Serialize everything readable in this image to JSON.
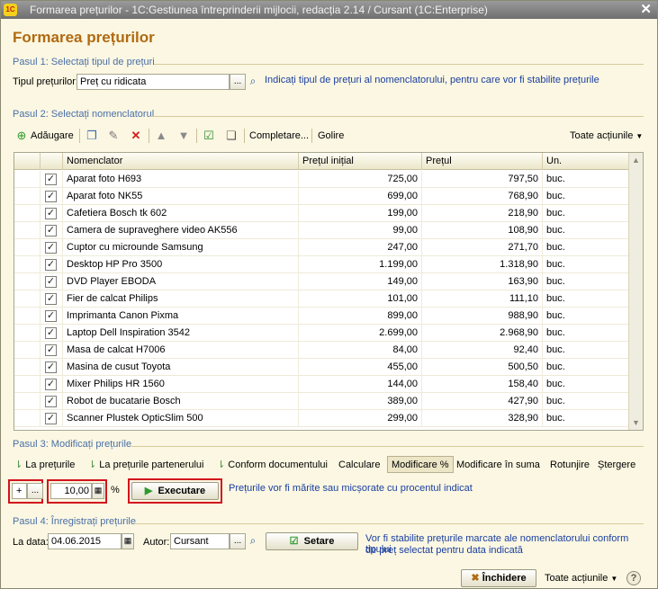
{
  "window": {
    "title": "Formarea prețurilor - 1C:Gestiunea întreprinderii mijlocii, redacția 2.14 / Cursant  (1C:Enterprise)",
    "logo_text": "1C",
    "close_glyph": "✕"
  },
  "heading": "Formarea prețurilor",
  "step1": {
    "title": "Pasul 1: Selectați tipul de prețuri",
    "label": "Tipul prețurilor:",
    "value": "Preț cu ridicata",
    "select_glyph": "...",
    "hint": "Indicați tipul de prețuri al nomenclatorului, pentru care vor fi stabilite prețurile"
  },
  "step2": {
    "title": "Pasul 2: Selectați nomenclatorul",
    "toolbar": {
      "add": "Adăugare",
      "fill": "Completare...",
      "clear": "Golire",
      "all_actions": "Toate acțiunile"
    },
    "columns": [
      "Nomenclator",
      "Prețul inițial",
      "Prețul",
      "Un."
    ],
    "rows": [
      {
        "name": "Aparat foto H693",
        "initial": "725,00",
        "price": "797,50",
        "unit": "buc."
      },
      {
        "name": "Aparat foto NK55",
        "initial": "699,00",
        "price": "768,90",
        "unit": "buc."
      },
      {
        "name": "Cafetiera Bosch tk 602",
        "initial": "199,00",
        "price": "218,90",
        "unit": "buc."
      },
      {
        "name": "Camera de supraveghere video AK556",
        "initial": "99,00",
        "price": "108,90",
        "unit": "buc."
      },
      {
        "name": "Cuptor cu microunde Samsung",
        "initial": "247,00",
        "price": "271,70",
        "unit": "buc."
      },
      {
        "name": "Desktop HP Pro 3500",
        "initial": "1.199,00",
        "price": "1.318,90",
        "unit": "buc."
      },
      {
        "name": "DVD Player EBODA",
        "initial": "149,00",
        "price": "163,90",
        "unit": "buc."
      },
      {
        "name": "Fier de calcat Philips",
        "initial": "101,00",
        "price": "111,10",
        "unit": "buc."
      },
      {
        "name": "Imprimanta Canon Pixma",
        "initial": "899,00",
        "price": "988,90",
        "unit": "buc."
      },
      {
        "name": "Laptop Dell Inspiration 3542",
        "initial": "2.699,00",
        "price": "2.968,90",
        "unit": "buc."
      },
      {
        "name": "Masa de calcat H7006",
        "initial": "84,00",
        "price": "92,40",
        "unit": "buc."
      },
      {
        "name": "Masina de cusut Toyota",
        "initial": "455,00",
        "price": "500,50",
        "unit": "buc."
      },
      {
        "name": "Mixer Philips HR 1560",
        "initial": "144,00",
        "price": "158,40",
        "unit": "buc."
      },
      {
        "name": "Robot de bucatarie Bosch",
        "initial": "389,00",
        "price": "427,90",
        "unit": "buc."
      },
      {
        "name": "Scanner Plustek OpticSlim 500",
        "initial": "299,00",
        "price": "328,90",
        "unit": "buc."
      }
    ]
  },
  "step3": {
    "title": "Pasul 3: Modificați prețurile",
    "tabs": [
      "La prețurile",
      "La prețurile partenerului",
      "Conform documentului",
      "Calculare",
      "Modificare %",
      "Modificare în suma",
      "Rotunjire",
      "Ștergere"
    ],
    "active_tab": "Modificare %",
    "sign": "+",
    "select_glyph": "...",
    "percent_value": "10,00",
    "percent_sign": "%",
    "execute": "Executare",
    "hint": "Prețurile vor fi mărite sau micșorate cu procentul indicat"
  },
  "step4": {
    "title": "Pasul 4: Înregistrați prețurile",
    "date_label": "La data:",
    "date_value": "04.06.2015",
    "author_label": "Autor:",
    "author_value": "Cursant",
    "select_glyph": "...",
    "set_button": "Setare",
    "hint_line1": "Vor fi stabilite prețurile marcate ale nomenclatorului conform tipului",
    "hint_line2": "de preț selectat pentru data indicată"
  },
  "footer": {
    "close": "Închidere",
    "all_actions": "Toate acțiunile",
    "help": "?"
  },
  "colors": {
    "heading": "#b06a12",
    "group_title": "#4a6fa8",
    "link": "#1a3ea0",
    "highlight_border": "#d2141c",
    "background": "#fbf7e2"
  }
}
